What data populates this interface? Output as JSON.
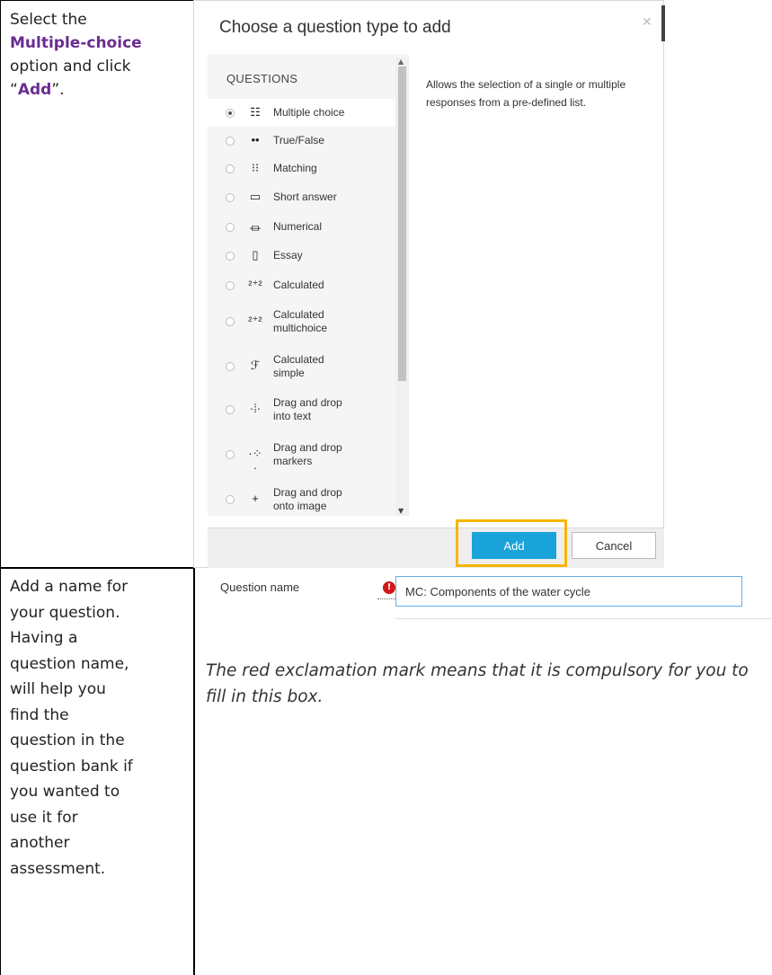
{
  "instructions": {
    "step1": {
      "prefix": "Select the",
      "highlight": "Multiple-choice",
      "middle": "option and click",
      "open_quote": "“",
      "action": "Add",
      "suffix": "”."
    },
    "step2": {
      "lines": [
        "Add a name for",
        "your question.",
        "Having a",
        "question name,",
        "will help you",
        "find the",
        "question in the",
        "question bank if",
        "you wanted to",
        "use it for",
        "another",
        "assessment."
      ]
    }
  },
  "dialog": {
    "title": "Choose a question type to add",
    "close_icon": "close-icon",
    "section_header": "QUESTIONS",
    "description": "Allows the selection of a single or multiple responses from a pre-defined list.",
    "items": [
      {
        "label": "Multiple choice",
        "icon": "☷",
        "selected": true
      },
      {
        "label": "True/False",
        "icon": "••"
      },
      {
        "label": "Matching",
        "icon": "⁝⁝"
      },
      {
        "label": "Short answer",
        "icon": "▭"
      },
      {
        "label": "Numerical",
        "icon": "⏛"
      },
      {
        "label": "Essay",
        "icon": "▯"
      },
      {
        "label": "Calculated",
        "icon": "²⁺²"
      },
      {
        "label": "Calculated\nmultichoice",
        "icon": "²⁺²"
      },
      {
        "label": "Calculated\nsimple",
        "icon": "ℱ"
      },
      {
        "label": "Drag and drop\ninto text",
        "icon": "·⁞·"
      },
      {
        "label": "Drag and drop\nmarkers",
        "icon": "·⁘·"
      },
      {
        "label": "Drag and drop\nonto image",
        "icon": "+"
      }
    ],
    "add_label": "Add",
    "cancel_label": "Cancel"
  },
  "form": {
    "question_name_label": "Question name",
    "required_icon": "!",
    "question_name_value": "MC: Components of the water cycle"
  },
  "note": "The red exclamation mark means that it is compulsory for you to fill in this box."
}
